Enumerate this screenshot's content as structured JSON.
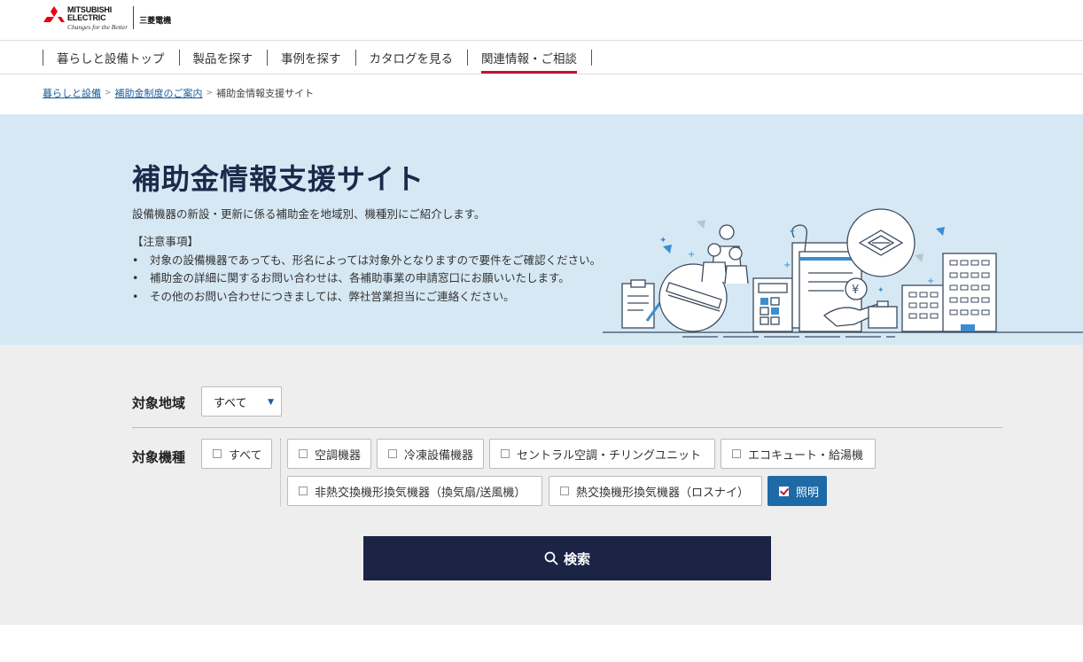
{
  "header": {
    "logo_en_line1": "MITSUBISHI",
    "logo_en_line2": "ELECTRIC",
    "logo_tagline": "Changes for the Better",
    "logo_jp": "三菱電機"
  },
  "nav": {
    "items": [
      "暮らしと設備トップ",
      "製品を探す",
      "事例を探す",
      "カタログを見る",
      "関連情報・ご相談"
    ],
    "active_index": 4
  },
  "breadcrumb": {
    "items": [
      "暮らしと設備",
      "補助金制度のご案内",
      "補助金情報支援サイト"
    ],
    "separator": ">"
  },
  "hero": {
    "title": "補助金情報支援サイト",
    "description": "設備機器の新設・更新に係る補助金を地域別、機種別にご紹介します。",
    "notice_heading": "【注意事項】",
    "notices": [
      "対象の設備機器であっても、形名によっては対象外となりますので要件をご確認ください。",
      "補助金の詳細に関するお問い合わせは、各補助事業の申請窓口にお願いいたします。",
      "その他のお問い合わせにつきましては、弊社営業担当にご連絡ください。"
    ],
    "illustration_icons": [
      "clipboard-icon",
      "light-fixture-icon",
      "people-icon",
      "calculator-icon",
      "document-icon",
      "yen-hand-icon",
      "ceiling-ac-icon",
      "building-icon"
    ]
  },
  "search": {
    "region_label": "対象地域",
    "region_selected": "すべて",
    "type_label": "対象機種",
    "types": [
      {
        "label": "すべて",
        "checked": false
      },
      {
        "label": "空調機器",
        "checked": false
      },
      {
        "label": "冷凍設備機器",
        "checked": false
      },
      {
        "label": "セントラル空調・チリングユニット",
        "checked": false
      },
      {
        "label": "エコキュート・給湯機",
        "checked": false
      },
      {
        "label": "非熱交換機形換気機器（換気扇/送風機）",
        "checked": false
      },
      {
        "label": "熱交換機形換気機器（ロスナイ）",
        "checked": false
      },
      {
        "label": "照明",
        "checked": true
      }
    ],
    "button_label": "検索"
  },
  "colors": {
    "hero_bg": "#d6e8f4",
    "accent_red": "#c8102e",
    "navy": "#1b2445",
    "checked_blue": "#1e6aa6"
  }
}
